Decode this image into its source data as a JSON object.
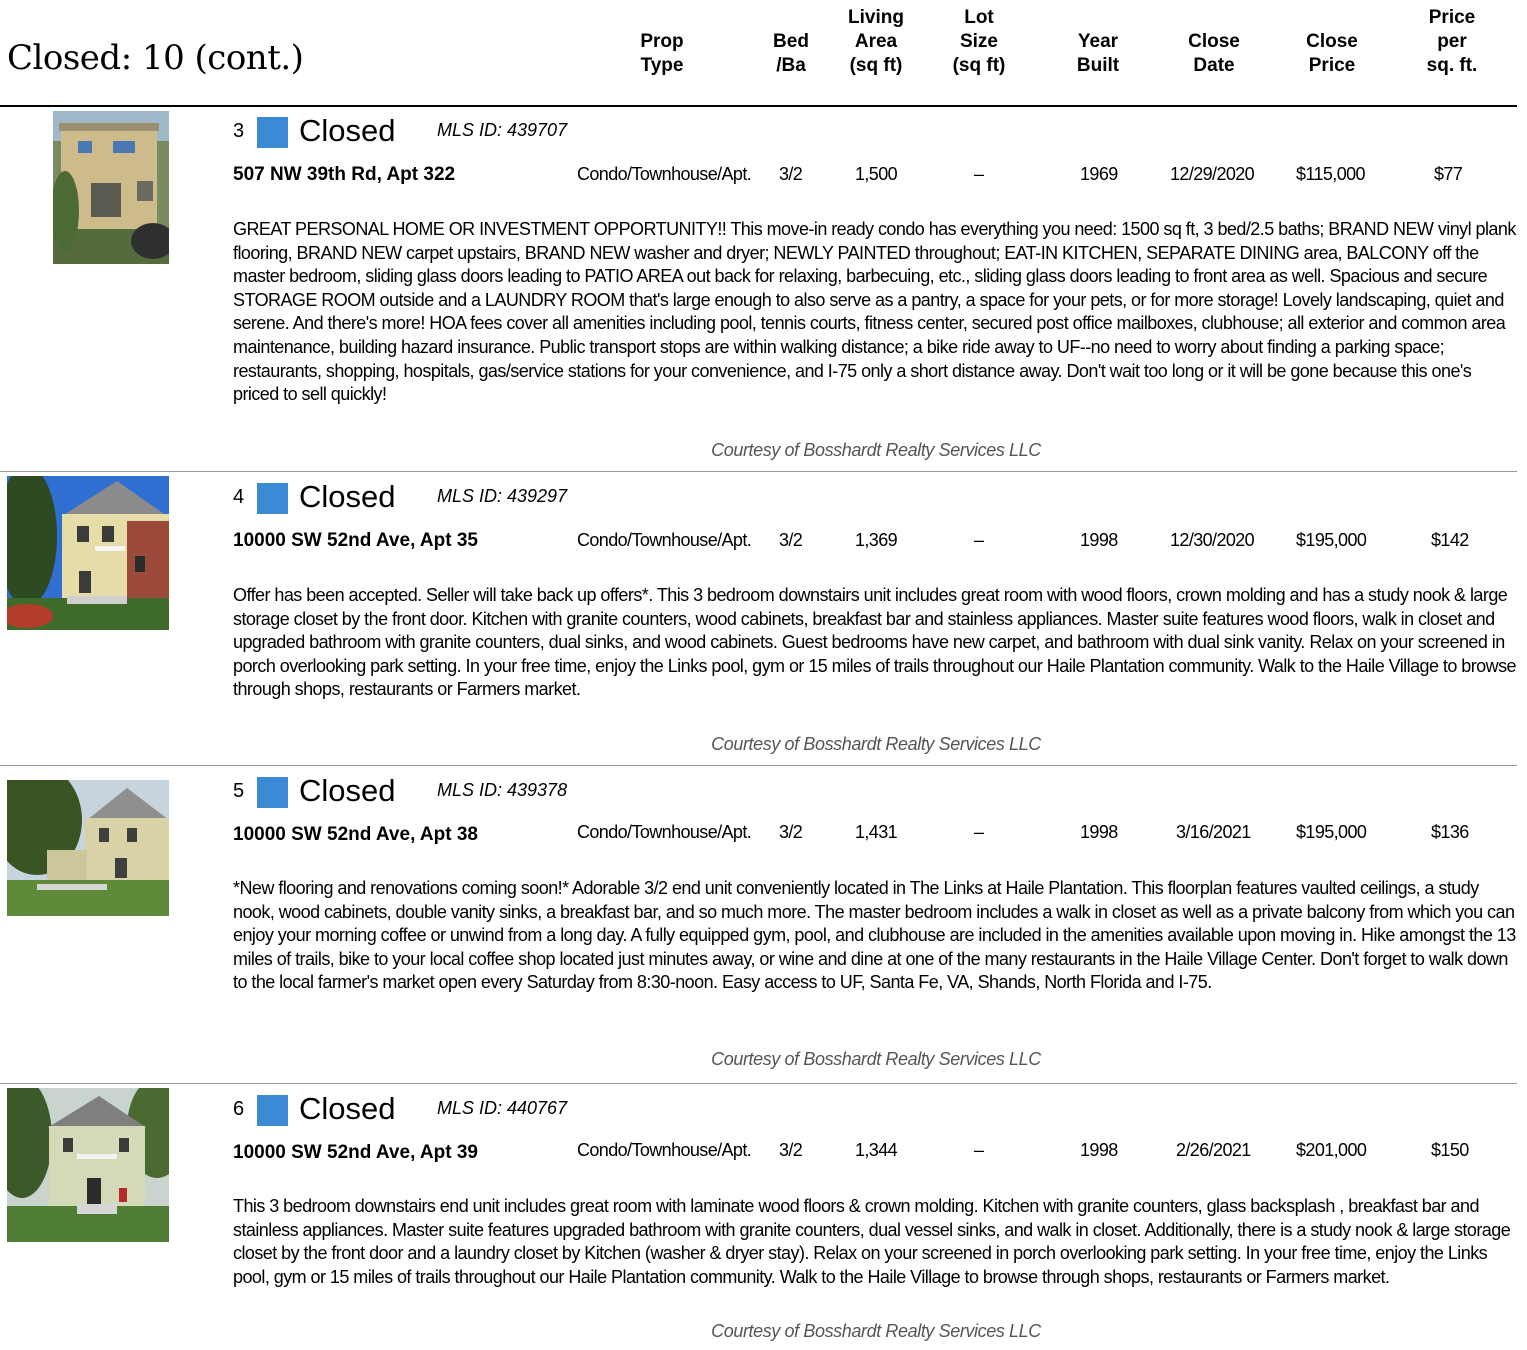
{
  "page_title": "Closed: 10 (cont.)",
  "columns": {
    "prop_type": "Prop\nType",
    "bed_ba": "Bed\n/Ba",
    "living_area": "Living\nArea\n(sq ft)",
    "lot_size": "Lot\nSize\n(sq ft)",
    "year_built": "Year\nBuilt",
    "close_date": "Close\nDate",
    "close_price": "Close\nPrice",
    "price_per_sqft": "Price\nper\nsq. ft."
  },
  "status_color": "#3a8ad6",
  "listings": [
    {
      "num": "3",
      "status": "Closed",
      "mls": "MLS ID: 439707",
      "address": "507 NW 39th Rd, Apt 322",
      "prop_type": "Condo/Townhouse/Apt.",
      "bed_ba": "3/2",
      "living_area": "1,500",
      "lot_size": "–",
      "year_built": "1969",
      "close_date": "12/29/2020",
      "close_price": "$115,000",
      "price_per_sqft": "$77",
      "description": "GREAT PERSONAL HOME OR INVESTMENT OPPORTUNITY!! This move-in ready condo has everything you need: 1500 sq ft, 3 bed/2.5 baths; BRAND NEW vinyl plank flooring, BRAND NEW carpet upstairs, BRAND NEW washer and dryer; NEWLY PAINTED throughout; EAT-IN KITCHEN, SEPARATE DINING area, BALCONY off the master bedroom, sliding glass doors leading to PATIO AREA out back for relaxing, barbecuing, etc., sliding glass doors leading to front area as well. Spacious and secure STORAGE ROOM outside and a LAUNDRY ROOM that's large enough to also serve as a pantry, a space for your pets, or for more storage! Lovely landscaping, quiet and serene. And there's more! HOA fees cover all amenities including pool, tennis courts, fitness center, secured post office mailboxes, clubhouse; all exterior and common area maintenance, building hazard insurance. Public transport stops are within walking distance; a bike ride away to UF--no need to worry about finding a parking space; restaurants, shopping, hospitals, gas/service stations for your convenience, and I-75 only a short distance away. Don't wait too long or it will be gone because this one's priced to sell quickly!",
      "courtesy": "Courtesy of Bosshardt Realty Services LLC"
    },
    {
      "num": "4",
      "status": "Closed",
      "mls": "MLS ID: 439297",
      "address": "10000 SW 52nd Ave, Apt 35",
      "prop_type": "Condo/Townhouse/Apt.",
      "bed_ba": "3/2",
      "living_area": "1,369",
      "lot_size": "–",
      "year_built": "1998",
      "close_date": "12/30/2020",
      "close_price": "$195,000",
      "price_per_sqft": "$142",
      "description": "Offer has been accepted. Seller will take back up offers*. This 3 bedroom downstairs unit includes great room with wood floors, crown molding and has a study nook & large storage closet by the front door. Kitchen with granite counters, wood cabinets, breakfast bar and stainless appliances. Master suite features wood floors, walk in closet and upgraded bathroom with granite counters, dual sinks, and wood cabinets. Guest bedrooms have new carpet, and bathroom with dual sink vanity. Relax on your screened in porch overlooking park setting. In your free time, enjoy the Links pool, gym or 15 miles of trails throughout our Haile Plantation community. Walk to the Haile Village to browse through shops, restaurants or Farmers market.",
      "courtesy": "Courtesy of Bosshardt Realty Services LLC"
    },
    {
      "num": "5",
      "status": "Closed",
      "mls": "MLS ID: 439378",
      "address": "10000 SW 52nd Ave, Apt 38",
      "prop_type": "Condo/Townhouse/Apt.",
      "bed_ba": "3/2",
      "living_area": "1,431",
      "lot_size": "–",
      "year_built": "1998",
      "close_date": "3/16/2021",
      "close_price": "$195,000",
      "price_per_sqft": "$136",
      "description": "*New flooring and renovations coming soon!* Adorable 3/2 end unit conveniently located in The Links at Haile Plantation. This floorplan features vaulted ceilings, a study nook, wood cabinets, double vanity sinks, a breakfast bar, and so much more. The master bedroom includes a walk in closet as well as a private balcony from which you can enjoy your morning coffee or unwind from a long day. A fully equipped gym, pool, and clubhouse are included in the amenities available upon moving in. Hike amongst the 13 miles of trails, bike to your local coffee shop located just minutes away, or wine and dine at one of the many restaurants in the Haile Village Center. Don't forget to walk down to the local farmer's market open every Saturday from 8:30-noon. Easy access to UF, Santa Fe, VA, Shands, North Florida and I-75.",
      "courtesy": "Courtesy of Bosshardt Realty Services LLC"
    },
    {
      "num": "6",
      "status": "Closed",
      "mls": "MLS ID: 440767",
      "address": "10000 SW 52nd Ave, Apt 39",
      "prop_type": "Condo/Townhouse/Apt.",
      "bed_ba": "3/2",
      "living_area": "1,344",
      "lot_size": "–",
      "year_built": "1998",
      "close_date": "2/26/2021",
      "close_price": "$201,000",
      "price_per_sqft": "$150",
      "description": "This 3 bedroom downstairs end unit includes great room with laminate wood floors & crown molding. Kitchen with granite counters, glass backsplash , breakfast bar and stainless appliances. Master suite features upgraded bathroom with granite counters, dual vessel sinks, and walk in closet. Additionally, there is a study nook & large storage closet by the front door and a laundry closet by Kitchen (washer & dryer stay). Relax on your screened in porch overlooking park setting. In your free time, enjoy the Links pool, gym or 15 miles of trails throughout our Haile Plantation community. Walk to the Haile Village to browse through shops, restaurants or Farmers market.",
      "courtesy": "Courtesy of Bosshardt Realty Services LLC"
    }
  ]
}
